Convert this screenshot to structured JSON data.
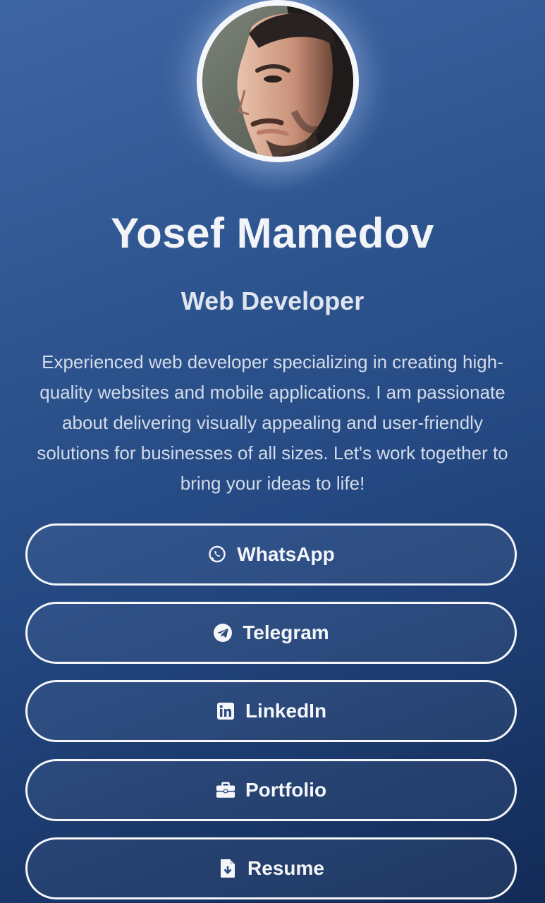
{
  "profile": {
    "name": "Yosef Mamedov",
    "role": "Web Developer",
    "bio": "Experienced web developer specializing in creating high-quality websites and mobile applications. I am passionate about delivering visually appealing and user-friendly solutions for businesses of all sizes. Let's work together to bring your ideas to life!"
  },
  "links": [
    {
      "label": "WhatsApp",
      "icon": "whatsapp-icon"
    },
    {
      "label": "Telegram",
      "icon": "telegram-icon"
    },
    {
      "label": "LinkedIn",
      "icon": "linkedin-icon"
    },
    {
      "label": "Portfolio",
      "icon": "briefcase-icon"
    },
    {
      "label": "Resume",
      "icon": "file-download-icon"
    }
  ],
  "colors": {
    "background_top": "#3f66a4",
    "background_bottom": "#122b57",
    "button_border": "#f4f6fa",
    "text": "#f2f4f8"
  }
}
